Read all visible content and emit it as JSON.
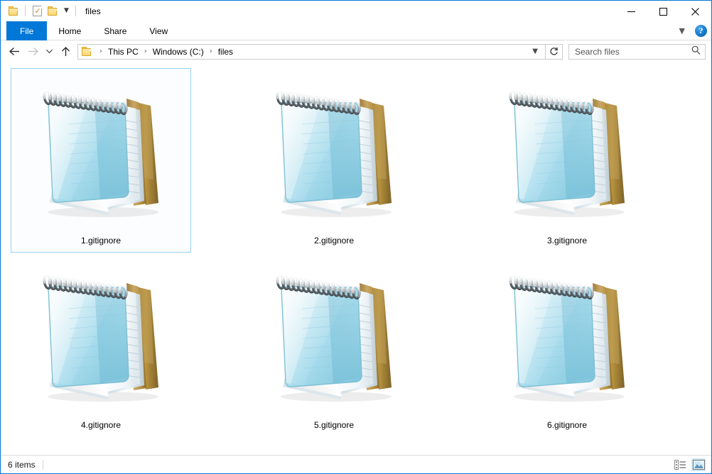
{
  "window": {
    "title": "files",
    "quick_access": [
      {
        "name": "folder-icon",
        "label": "Folder"
      },
      {
        "name": "properties-icon",
        "label": "Properties"
      },
      {
        "name": "new-folder-icon",
        "label": "New folder"
      },
      {
        "name": "chevron-down-icon",
        "label": "Customize Quick Access Toolbar"
      }
    ],
    "controls": {
      "minimize": "Minimize",
      "maximize": "Maximize",
      "close": "Close"
    }
  },
  "ribbon": {
    "tabs": [
      {
        "label": "File",
        "active": true
      },
      {
        "label": "Home",
        "active": false
      },
      {
        "label": "Share",
        "active": false
      },
      {
        "label": "View",
        "active": false
      }
    ],
    "collapse_label": "Minimize the Ribbon",
    "help_label": "?"
  },
  "navigation": {
    "back_label": "Back",
    "forward_label": "Forward",
    "recent_label": "Recent locations",
    "up_label": "Up",
    "refresh_label": "Refresh",
    "crumb_dropdown_label": "Previous locations",
    "breadcrumb": [
      "This PC",
      "Windows (C:)",
      "files"
    ],
    "separator": "›"
  },
  "search": {
    "placeholder": "Search files",
    "value": "",
    "icon": "search-icon"
  },
  "files": [
    {
      "name": "1.gitignore",
      "icon": "notepad-icon",
      "selected": true
    },
    {
      "name": "2.gitignore",
      "icon": "notepad-icon",
      "selected": false
    },
    {
      "name": "3.gitignore",
      "icon": "notepad-icon",
      "selected": false
    },
    {
      "name": "4.gitignore",
      "icon": "notepad-icon",
      "selected": false
    },
    {
      "name": "5.gitignore",
      "icon": "notepad-icon",
      "selected": false
    },
    {
      "name": "6.gitignore",
      "icon": "notepad-icon",
      "selected": false
    }
  ],
  "status": {
    "item_count": "6 items",
    "views": [
      {
        "name": "details-view-button",
        "label": "Details view",
        "active": false
      },
      {
        "name": "large-icons-view-button",
        "label": "Large icons view",
        "active": true
      }
    ]
  },
  "colors": {
    "accent": "#0078d7",
    "selection_border": "#99d1f0",
    "selection_fill": "#fbfdfe",
    "notepad_cover": "#9ed4e6",
    "notepad_easel": "#b08a44"
  }
}
